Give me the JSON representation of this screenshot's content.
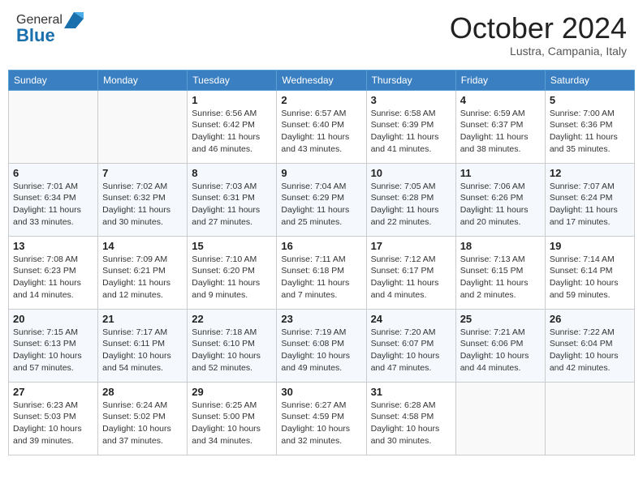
{
  "header": {
    "logo_general": "General",
    "logo_blue": "Blue",
    "month": "October 2024",
    "location": "Lustra, Campania, Italy"
  },
  "weekdays": [
    "Sunday",
    "Monday",
    "Tuesday",
    "Wednesday",
    "Thursday",
    "Friday",
    "Saturday"
  ],
  "weeks": [
    [
      {
        "day": "",
        "info": ""
      },
      {
        "day": "",
        "info": ""
      },
      {
        "day": "1",
        "info": "Sunrise: 6:56 AM\nSunset: 6:42 PM\nDaylight: 11 hours and 46 minutes."
      },
      {
        "day": "2",
        "info": "Sunrise: 6:57 AM\nSunset: 6:40 PM\nDaylight: 11 hours and 43 minutes."
      },
      {
        "day": "3",
        "info": "Sunrise: 6:58 AM\nSunset: 6:39 PM\nDaylight: 11 hours and 41 minutes."
      },
      {
        "day": "4",
        "info": "Sunrise: 6:59 AM\nSunset: 6:37 PM\nDaylight: 11 hours and 38 minutes."
      },
      {
        "day": "5",
        "info": "Sunrise: 7:00 AM\nSunset: 6:36 PM\nDaylight: 11 hours and 35 minutes."
      }
    ],
    [
      {
        "day": "6",
        "info": "Sunrise: 7:01 AM\nSunset: 6:34 PM\nDaylight: 11 hours and 33 minutes."
      },
      {
        "day": "7",
        "info": "Sunrise: 7:02 AM\nSunset: 6:32 PM\nDaylight: 11 hours and 30 minutes."
      },
      {
        "day": "8",
        "info": "Sunrise: 7:03 AM\nSunset: 6:31 PM\nDaylight: 11 hours and 27 minutes."
      },
      {
        "day": "9",
        "info": "Sunrise: 7:04 AM\nSunset: 6:29 PM\nDaylight: 11 hours and 25 minutes."
      },
      {
        "day": "10",
        "info": "Sunrise: 7:05 AM\nSunset: 6:28 PM\nDaylight: 11 hours and 22 minutes."
      },
      {
        "day": "11",
        "info": "Sunrise: 7:06 AM\nSunset: 6:26 PM\nDaylight: 11 hours and 20 minutes."
      },
      {
        "day": "12",
        "info": "Sunrise: 7:07 AM\nSunset: 6:24 PM\nDaylight: 11 hours and 17 minutes."
      }
    ],
    [
      {
        "day": "13",
        "info": "Sunrise: 7:08 AM\nSunset: 6:23 PM\nDaylight: 11 hours and 14 minutes."
      },
      {
        "day": "14",
        "info": "Sunrise: 7:09 AM\nSunset: 6:21 PM\nDaylight: 11 hours and 12 minutes."
      },
      {
        "day": "15",
        "info": "Sunrise: 7:10 AM\nSunset: 6:20 PM\nDaylight: 11 hours and 9 minutes."
      },
      {
        "day": "16",
        "info": "Sunrise: 7:11 AM\nSunset: 6:18 PM\nDaylight: 11 hours and 7 minutes."
      },
      {
        "day": "17",
        "info": "Sunrise: 7:12 AM\nSunset: 6:17 PM\nDaylight: 11 hours and 4 minutes."
      },
      {
        "day": "18",
        "info": "Sunrise: 7:13 AM\nSunset: 6:15 PM\nDaylight: 11 hours and 2 minutes."
      },
      {
        "day": "19",
        "info": "Sunrise: 7:14 AM\nSunset: 6:14 PM\nDaylight: 10 hours and 59 minutes."
      }
    ],
    [
      {
        "day": "20",
        "info": "Sunrise: 7:15 AM\nSunset: 6:13 PM\nDaylight: 10 hours and 57 minutes."
      },
      {
        "day": "21",
        "info": "Sunrise: 7:17 AM\nSunset: 6:11 PM\nDaylight: 10 hours and 54 minutes."
      },
      {
        "day": "22",
        "info": "Sunrise: 7:18 AM\nSunset: 6:10 PM\nDaylight: 10 hours and 52 minutes."
      },
      {
        "day": "23",
        "info": "Sunrise: 7:19 AM\nSunset: 6:08 PM\nDaylight: 10 hours and 49 minutes."
      },
      {
        "day": "24",
        "info": "Sunrise: 7:20 AM\nSunset: 6:07 PM\nDaylight: 10 hours and 47 minutes."
      },
      {
        "day": "25",
        "info": "Sunrise: 7:21 AM\nSunset: 6:06 PM\nDaylight: 10 hours and 44 minutes."
      },
      {
        "day": "26",
        "info": "Sunrise: 7:22 AM\nSunset: 6:04 PM\nDaylight: 10 hours and 42 minutes."
      }
    ],
    [
      {
        "day": "27",
        "info": "Sunrise: 6:23 AM\nSunset: 5:03 PM\nDaylight: 10 hours and 39 minutes."
      },
      {
        "day": "28",
        "info": "Sunrise: 6:24 AM\nSunset: 5:02 PM\nDaylight: 10 hours and 37 minutes."
      },
      {
        "day": "29",
        "info": "Sunrise: 6:25 AM\nSunset: 5:00 PM\nDaylight: 10 hours and 34 minutes."
      },
      {
        "day": "30",
        "info": "Sunrise: 6:27 AM\nSunset: 4:59 PM\nDaylight: 10 hours and 32 minutes."
      },
      {
        "day": "31",
        "info": "Sunrise: 6:28 AM\nSunset: 4:58 PM\nDaylight: 10 hours and 30 minutes."
      },
      {
        "day": "",
        "info": ""
      },
      {
        "day": "",
        "info": ""
      }
    ]
  ]
}
